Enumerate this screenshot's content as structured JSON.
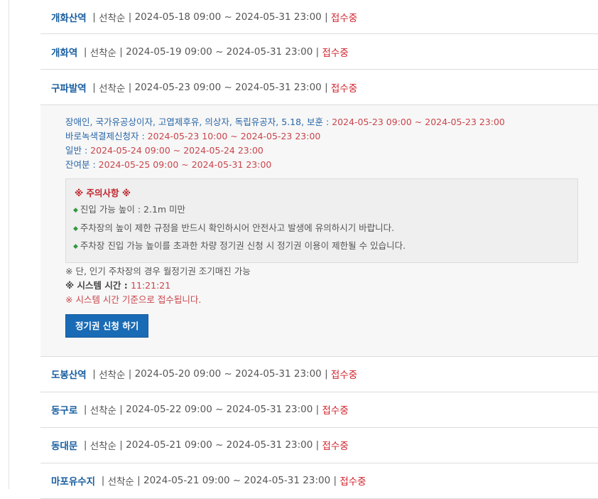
{
  "stations": [
    {
      "name": "개화산역",
      "method": "선착순",
      "period": "2024-05-18 09:00 ~ 2024-05-31 23:00",
      "status": "접수중"
    },
    {
      "name": "개화역",
      "method": "선착순",
      "period": "2024-05-19 09:00 ~ 2024-05-31 23:00",
      "status": "접수중"
    },
    {
      "name": "구파발역",
      "method": "선착순",
      "period": "2024-05-23 09:00 ~ 2024-05-31 23:00",
      "status": "접수중"
    },
    {
      "name": "도봉산역",
      "method": "선착순",
      "period": "2024-05-20 09:00 ~ 2024-05-31 23:00",
      "status": "접수중"
    },
    {
      "name": "동구로",
      "method": "선착순",
      "period": "2024-05-22 09:00 ~ 2024-05-31 23:00",
      "status": "접수중"
    },
    {
      "name": "동대문",
      "method": "선착순",
      "period": "2024-05-21 09:00 ~ 2024-05-31 23:00",
      "status": "접수중"
    },
    {
      "name": "마포유수지",
      "method": "선착순",
      "period": "2024-05-21 09:00 ~ 2024-05-31 23:00",
      "status": "접수중"
    }
  ],
  "separator": "|",
  "detail": {
    "schedule": [
      {
        "label": "장애인, 국가유공상이자, 고엽제후유, 의상자, 독립유공자, 5.18, 보훈 : ",
        "period": "2024-05-23 09:00 ~ 2024-05-23 23:00"
      },
      {
        "label": "바로녹색결제신청자 : ",
        "period": "2024-05-23 10:00 ~ 2024-05-23 23:00"
      },
      {
        "label": "일반 : ",
        "period": "2024-05-24 09:00 ~ 2024-05-24 23:00"
      },
      {
        "label": "잔여분 : ",
        "period": "2024-05-25 09:00 ~ 2024-05-31 23:00"
      }
    ],
    "notice_title": "※ 주의사항 ※",
    "notice_items": [
      "진입 가능 높이 : 2.1m 미만",
      "주차장의 높이 제한 규정을 반드시 확인하시어 안전사고 발생에 유의하시기 바랍니다.",
      "주차장 진입 가능 높이를 초과한 차량 정기권 신청 시 정기권 이용이 제한될 수 있습니다."
    ],
    "bullet": "◆",
    "extra_note": "※ 단, 인기 주차장의 경우 월정기권 조기매진 가능",
    "system_time_label": "※ 시스템 시간 : ",
    "system_time_value": "11:21:21",
    "system_time_note": "※ 시스템 시간 기준으로 접수됩니다.",
    "apply_button": "정기권 신청 하기"
  },
  "colors": {
    "link": "#1a5fa0",
    "status": "#d0202a",
    "button": "#1a6bb5"
  }
}
